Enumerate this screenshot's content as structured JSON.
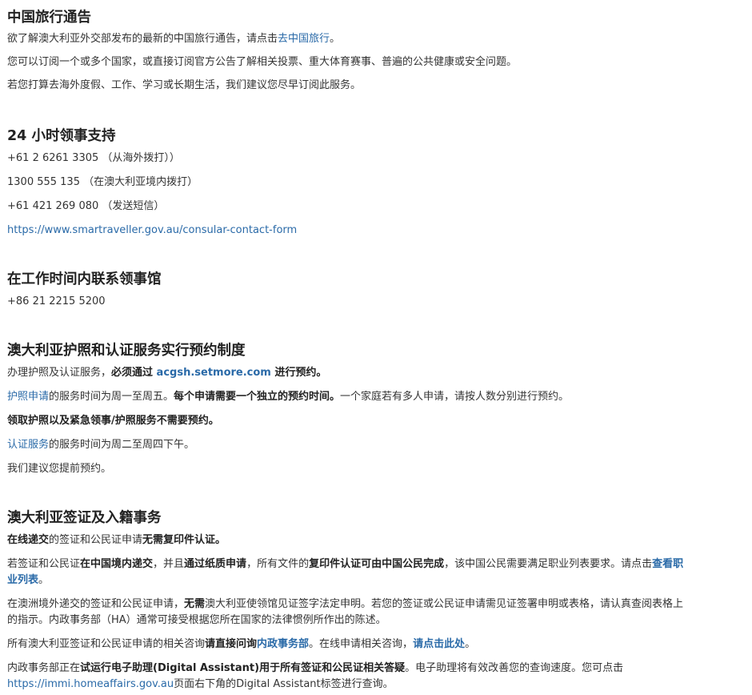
{
  "section1": {
    "title": "中国旅行通告",
    "p1_pre": "欲了解澳大利亚外交部发布的最新的中国旅行通告，请点击",
    "p1_link": "去中国旅行",
    "p1_post": "。",
    "p2": "您可以订阅一个或多个国家，或直接订阅官方公告了解相关投票、重大体育赛事、普遍的公共健康或安全问题。",
    "p3": "若您打算去海外度假、工作、学习或长期生活，我们建议您尽早订阅此服务。"
  },
  "section2": {
    "title": "24 小时领事支持",
    "line1": "+61 2 6261 3305 （从海外拨打））",
    "line2": "1300 555 135 （在澳大利亚境内拨打）",
    "line3": "+61 421 269 080 （发送短信）",
    "link": "https://www.smartraveller.gov.au/consular-contact-form"
  },
  "section3": {
    "title": "在工作时间内联系领事馆",
    "phone": "+86 21 2215 5200"
  },
  "section4": {
    "title": "澳大利亚护照和认证服务实行预约制度",
    "p1_pre": "办理护照及认证服务，",
    "p1_bold": "必须通过 ",
    "p1_link": "acgsh.setmore.com",
    "p1_bold2": " 进行预约。",
    "p2_link": "护照申请",
    "p2_text": "的服务时间为周一至周五。",
    "p2_bold": "每个申请需要一个独立的预约时间。",
    "p2_tail": "一个家庭若有多人申请，请按人数分别进行预约。",
    "p3_bold": "领取护照以及紧急领事/护照服务不需要预约。",
    "p4_link": "认证服务",
    "p4_text": "的服务时间为周二至周四下午。",
    "p5": "我们建议您提前预约。"
  },
  "section5": {
    "title": "澳大利亚签证及入籍事务",
    "p1_bold1": "在线递交",
    "p1_text": "的签证和公民证申请",
    "p1_bold2": "无需复印件认证。",
    "p2_a": "若签证和公民证",
    "p2_b": "在中国境内递交",
    "p2_c": "，并且",
    "p2_d": "通过纸质申请",
    "p2_e": "，所有文件的",
    "p2_f": "复印件认证可由中国公民完成",
    "p2_g": "，该中国公民需要满足职业列表要求。请点击",
    "p2_link": "查看职业列表",
    "p2_h": "。",
    "p3_a": "在澳洲境外递交的签证和公民证申请，",
    "p3_b": "无需",
    "p3_c": "澳大利亚使领馆见证签字法定申明。若您的签证或公民证申请需见证签署申明或表格，请认真查阅表格上的指示。内政事务部（HA）通常可接受根据您所在国家的法律惯例所作出的陈述。",
    "p4_a": "所有澳大利亚签证和公民证申请的相关咨询",
    "p4_b": "请直接问询",
    "p4_link": "内政事务部",
    "p4_c": "。在线申请相关咨询，",
    "p4_link2": "请点击此处",
    "p4_d": "。",
    "p5_a": "内政事务部正在",
    "p5_b": "试运行电子助理(Digital Assistant)用于所有签证和公民证相关答疑",
    "p5_c": "。电子助理将有效改善您的查询速度。您可点击",
    "p5_link": "https://immi.homeaffairs.gov.au",
    "p5_d": "页面右下角的Digital Assistant标签进行查询。"
  }
}
